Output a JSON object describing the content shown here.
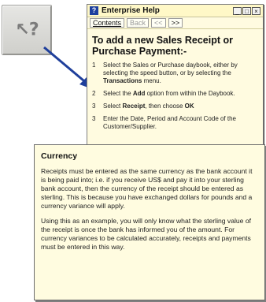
{
  "help_button": {
    "glyph": "↖?"
  },
  "window": {
    "title": "Enterprise Help",
    "controls": {
      "minimize": "_",
      "maximize": "□",
      "close": "×"
    },
    "tabs": [
      {
        "label": "Contents",
        "disabled": false
      },
      {
        "label": "Back",
        "disabled": true
      },
      {
        "label": "<<",
        "disabled": true
      },
      {
        "label": ">>",
        "disabled": false
      }
    ],
    "heading": "To add a new Sales Receipt or Purchase Payment:-",
    "steps": [
      {
        "num": "1",
        "before": "Select the Sales or Purchase daybook, either by selecting the speed button, or by selecting the ",
        "bold": "Transactions",
        "after": " menu."
      },
      {
        "num": "2",
        "before": "Select the ",
        "bold": "Add",
        "after": " option from within the Daybook."
      },
      {
        "num": "3",
        "before": "Select ",
        "bold": "Receipt",
        "after": ", then choose ",
        "bold2": "OK"
      },
      {
        "num": "3",
        "before": "Enter the Date, Period and Account Code of the Customer/Supplier.",
        "bold": "",
        "after": ""
      }
    ]
  },
  "popup": {
    "title": "Currency",
    "paragraphs": [
      "Receipts must be entered as the same currency as the bank account it is being paid into; i.e. if you receive US$ and pay it into your sterling bank account, then the currency of the receipt should be entered as sterling. This is because you have exchanged dollars for pounds and a currency variance will apply.",
      "Using this as an example, you will only know what the sterling value of the receipt is once the bank has informed you of the amount. For currency variances to be calculated accurately, receipts and payments must be entered in this way."
    ]
  }
}
